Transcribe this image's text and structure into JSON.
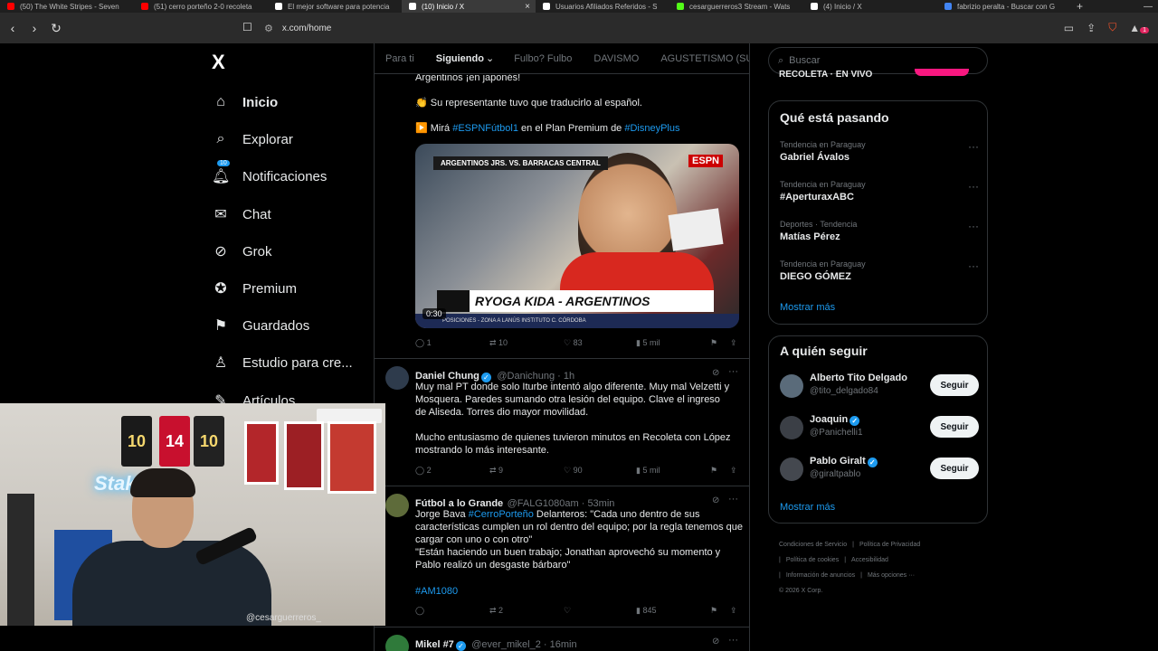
{
  "browser": {
    "tabs": [
      {
        "title": "(50) The White Stripes - Seven",
        "color": "#ff0000",
        "active": false
      },
      {
        "title": "(51) cerro porteño 2-0 recoleta",
        "color": "#ff0000",
        "active": false
      },
      {
        "title": "El mejor software para potencia",
        "color": "#ffffff",
        "active": false
      },
      {
        "title": "(10) Inicio / X",
        "color": "#ffffff",
        "active": true
      },
      {
        "title": "Usuarios Afiliados Referidos - S",
        "color": "#ffffff",
        "active": false
      },
      {
        "title": "cesarguerreros3 Stream - Wats",
        "color": "#53fc18",
        "active": false
      },
      {
        "title": "(4) Inicio / X",
        "color": "#ffffff",
        "active": false
      },
      {
        "title": "fabrizio peralta - Buscar con G",
        "color": "#4285f4",
        "active": false
      }
    ],
    "url": "x.com/home",
    "notif_count": "1"
  },
  "nav": {
    "logo": "X",
    "items": [
      {
        "label": "Inicio",
        "icon": "home-icon",
        "glyph": "⌂",
        "active": true
      },
      {
        "label": "Explorar",
        "icon": "search-icon",
        "glyph": "⌕",
        "active": false
      },
      {
        "label": "Notificaciones",
        "icon": "bell-icon",
        "glyph": "🔔︎",
        "active": false,
        "badge": "10"
      },
      {
        "label": "Chat",
        "icon": "mail-icon",
        "glyph": "✉",
        "active": false
      },
      {
        "label": "Grok",
        "icon": "grok-icon",
        "glyph": "⊘",
        "active": false
      },
      {
        "label": "Premium",
        "icon": "premium-icon",
        "glyph": "✪",
        "active": false
      },
      {
        "label": "Guardados",
        "icon": "bookmark-icon",
        "glyph": "⚑",
        "active": false
      },
      {
        "label": "Estudio para cre...",
        "icon": "studio-icon",
        "glyph": "♙",
        "active": false
      },
      {
        "label": "Artículos",
        "icon": "articles-icon",
        "glyph": "✎",
        "active": false
      }
    ]
  },
  "feed": {
    "tabs": [
      "Para ti",
      "Siguiendo",
      "Fulbo? Fulbo",
      "DAVISMO",
      "AGUSTETISMO (SU LID"
    ],
    "active_tab": "Siguiendo",
    "tweet1": {
      "line_top": "Argentinos ¡en japonés!",
      "line2": "👏 Su representante tuvo que traducirlo al español.",
      "line3_prefix": "▶️ Mirá ",
      "tag1": "#ESPNFútbol1",
      "line3_mid": " en el Plan Premium de ",
      "tag2": "#DisneyPlus",
      "video": {
        "top_caption": "ARGENTINOS JRS. VS. BARRACAS CENTRAL",
        "network": "ESPN",
        "lower_third": "RYOGA KIDA - ARGENTINOS",
        "ticker": "POSICIONES - ZONA A    LANÚS    INSTITUTO    C. CÓRDOBA",
        "duration": "0:30"
      },
      "replies": "1",
      "reposts": "10",
      "likes": "83",
      "views": "5 mil"
    },
    "tweet2": {
      "name": "Daniel Chung",
      "handle": "@Danichung · 1h",
      "text1": "Muy mal PT donde solo Iturbe intentó algo diferente. Muy mal Velzetti y Mosquera. Paredes sumando otra lesión del equipo. Clave el ingreso de Aliseda. Torres dio mayor movilidad.",
      "text2": "Mucho entusiasmo de quienes tuvieron minutos en Recoleta con López mostrando lo más interesante.",
      "replies": "2",
      "reposts": "9",
      "likes": "90",
      "views": "5 mil"
    },
    "tweet3": {
      "name": "Fútbol a lo Grande",
      "handle": "@FALG1080am · 53min",
      "text_prefix": "Jorge Bava ",
      "tag": "#CerroPorteño",
      "text_rest": " Delanteros: \"Cada uno dentro de sus características cumplen un rol dentro del equipo; por la regla tenemos que cargar con uno o con otro\"",
      "text2": "\"Están haciendo un buen trabajo; Jonathan aprovechó su momento y Pablo realizó un desgaste bárbaro\"",
      "tag2": "#AM1080",
      "replies": "",
      "reposts": "2",
      "likes": "",
      "views": "845"
    },
    "tweet4": {
      "name": "Mikel #7",
      "handle": "@ever_mikel_2 · 16min"
    }
  },
  "sidebar": {
    "search_placeholder": "Buscar",
    "live_text": "RECOLETA · EN VIVO",
    "trends_title": "Qué está pasando",
    "trends": [
      {
        "meta": "Tendencia en Paraguay",
        "topic": "Gabriel Ávalos"
      },
      {
        "meta": "Tendencia en Paraguay",
        "topic": "#AperturaxABC"
      },
      {
        "meta": "Deportes · Tendencia",
        "topic": "Matías Pérez"
      },
      {
        "meta": "Tendencia en Paraguay",
        "topic": "DIEGO GÓMEZ"
      }
    ],
    "show_more": "Mostrar más",
    "who_title": "A quién seguir",
    "who": [
      {
        "name": "Alberto Tito Delgado",
        "handle": "@tito_delgado84",
        "verified": false,
        "color": "#5a6b7a"
      },
      {
        "name": "Joaquin",
        "handle": "@Panichelli1",
        "verified": true,
        "color": "#3b3f46"
      },
      {
        "name": "Pablo Giralt",
        "handle": "@giraltpablo",
        "verified": true,
        "color": "#44484f"
      }
    ],
    "follow_label": "Seguir",
    "footer": [
      "Condiciones de Servicio",
      "|",
      "Política de Privacidad",
      "|",
      "Política de cookies",
      "|",
      "Accesibilidad",
      "|",
      "Información de anuncios",
      "|",
      "Más opciones ···",
      "© 2026 X Corp."
    ]
  },
  "webcam": {
    "neon": "Stake",
    "handle": "@cesarguerreros_",
    "jerseys": [
      "10",
      "14",
      "10"
    ]
  }
}
